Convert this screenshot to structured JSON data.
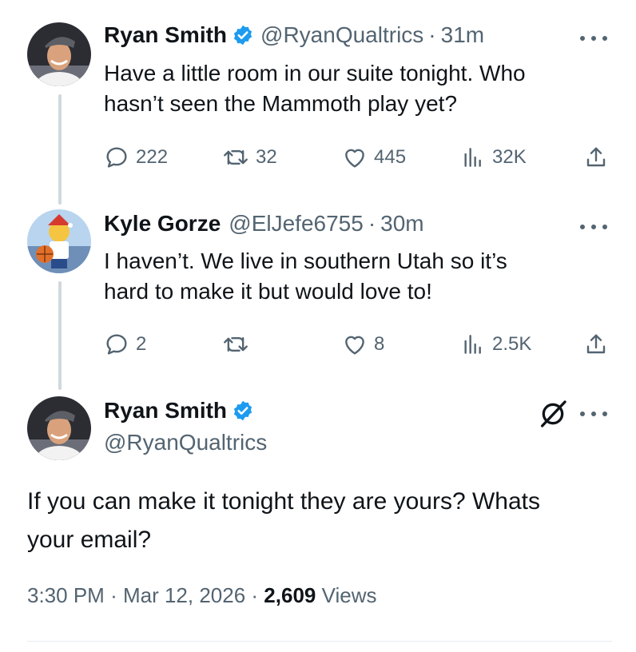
{
  "colors": {
    "accent": "#1d9bf0",
    "text": "#0f1419",
    "muted": "#536471",
    "thread_line": "#cfd9de"
  },
  "tweets": [
    {
      "name": "Ryan Smith",
      "verified": true,
      "handle": "@RyanQualtrics",
      "time": "31m",
      "line1": "Have a little room in our suite tonight.   Who",
      "line2": "hasn’t seen the Mammoth play yet?",
      "replies": "222",
      "retweets": "32",
      "likes": "445",
      "views": "32K"
    },
    {
      "name": "Kyle Gorze",
      "verified": false,
      "handle": "@ElJefe6755",
      "time": "30m",
      "line1": "I haven’t. We live in southern Utah so it’s",
      "line2": "hard to make it but would love to!",
      "replies": "2",
      "retweets": "",
      "likes": "8",
      "views": "2.5K"
    }
  ],
  "main_tweet": {
    "name": "Ryan Smith",
    "verified": true,
    "handle": "@RyanQualtrics",
    "line1": "If you can make it tonight they are yours?  Whats",
    "line2": "your email?",
    "time": "3:30 PM",
    "date": "Mar 12, 2026",
    "views_count": "2,609",
    "views_label": "Views"
  },
  "icons": [
    "verified-badge-icon",
    "more-icon",
    "reply-icon",
    "retweet-icon",
    "like-icon",
    "views-icon",
    "share-icon",
    "grok-icon"
  ]
}
